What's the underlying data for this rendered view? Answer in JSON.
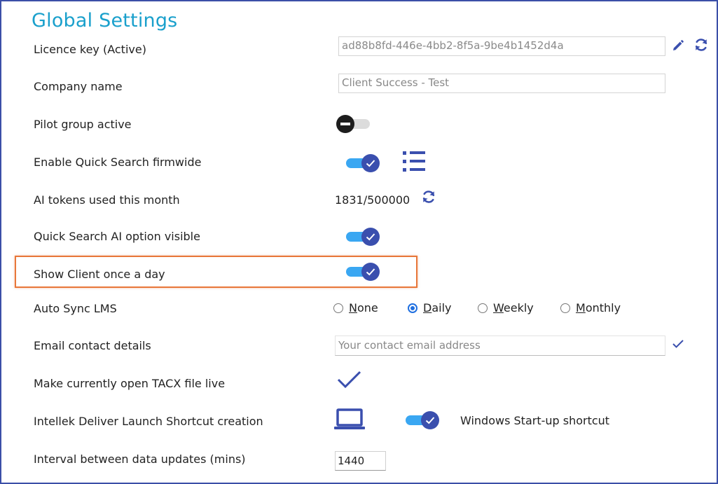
{
  "page": {
    "title": "Global Settings"
  },
  "rows": {
    "licence": {
      "label": "Licence key (Active)",
      "value": "ad88b8fd-446e-4bb2-8f5a-9be4b1452d4a"
    },
    "company": {
      "label": "Company name",
      "value": "Client Success - Test"
    },
    "pilot_group": {
      "label": "Pilot group active",
      "state": "off"
    },
    "quick_search": {
      "label": "Enable Quick Search firmwide",
      "state": "on"
    },
    "ai_tokens": {
      "label": "AI tokens used this month",
      "value": "1831/500000"
    },
    "qs_ai_visible": {
      "label": "Quick Search AI option visible",
      "state": "on"
    },
    "show_client": {
      "label": "Show Client once a day",
      "state": "on"
    },
    "auto_sync": {
      "label": "Auto Sync LMS",
      "options": [
        "None",
        "Daily",
        "Weekly",
        "Monthly"
      ],
      "selected": "Daily"
    },
    "email": {
      "label": "Email contact details",
      "placeholder": "Your contact email address"
    },
    "make_live": {
      "label": "Make currently open TACX file live"
    },
    "launch_shortcut": {
      "label": "Intellek Deliver Launch Shortcut creation",
      "startup_label": "Windows Start-up shortcut",
      "startup_state": "on"
    },
    "interval": {
      "label": "Interval between data updates (mins)",
      "value": "1440"
    }
  },
  "colors": {
    "accent_title": "#1aa0cc",
    "toggle_track": "#3aa7f2",
    "toggle_knob": "#3a4fae",
    "icon_blue": "#3a4fae",
    "highlight": "#e8773a",
    "radio_selected": "#1f6fe0"
  }
}
